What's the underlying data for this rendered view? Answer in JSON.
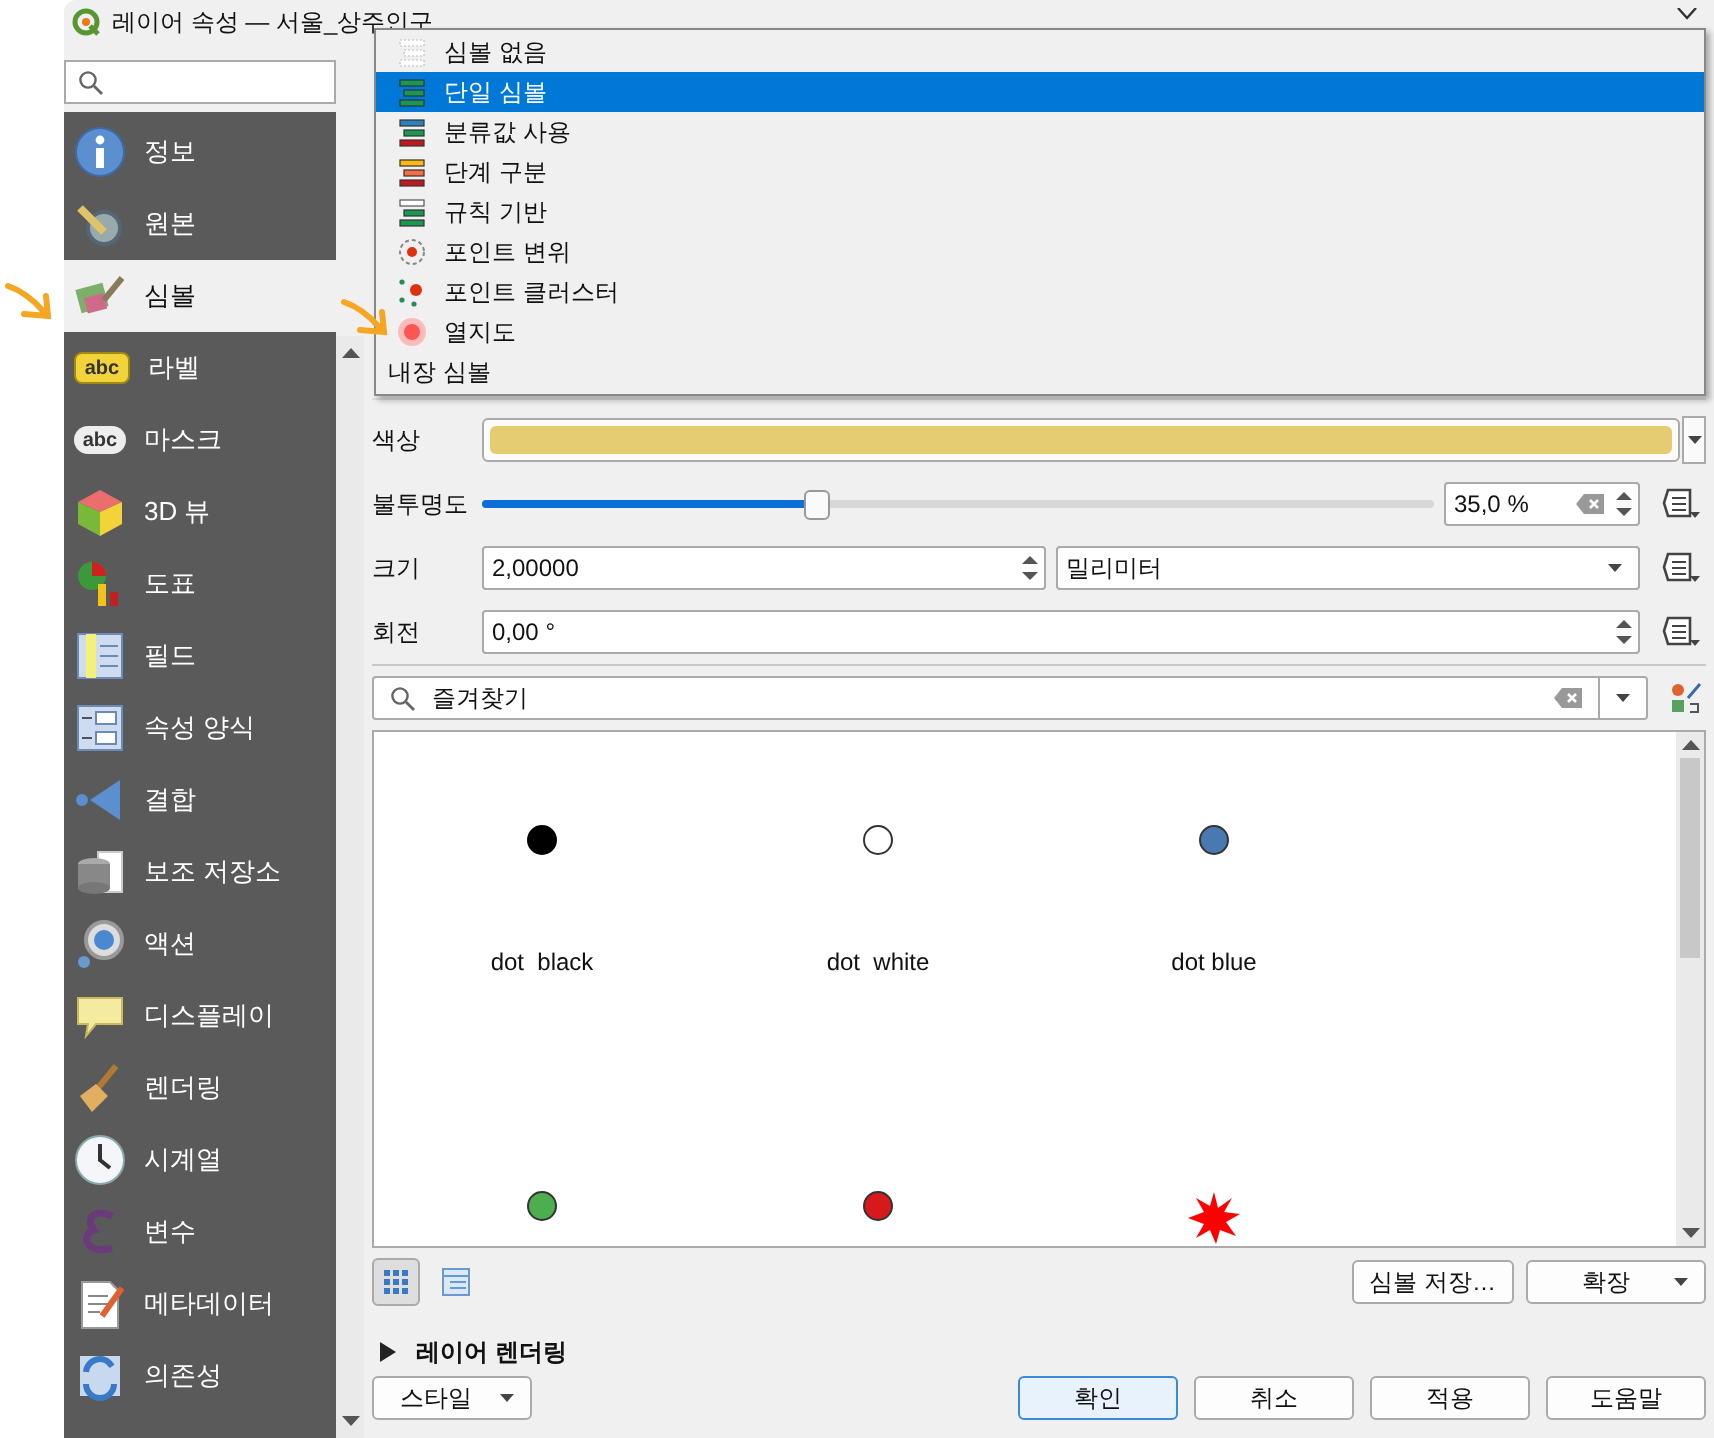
{
  "window": {
    "title": "레이어 속성 — 서울_상주인구"
  },
  "sidebar": {
    "items": [
      {
        "label": "정보",
        "selected": false
      },
      {
        "label": "원본",
        "selected": false
      },
      {
        "label": "심볼",
        "selected": true
      },
      {
        "label": "라벨",
        "selected": false,
        "badge": "abc"
      },
      {
        "label": "마스크",
        "selected": false,
        "badge": "abc"
      },
      {
        "label": "3D 뷰",
        "selected": false
      },
      {
        "label": "도표",
        "selected": false
      },
      {
        "label": "필드",
        "selected": false
      },
      {
        "label": "속성 양식",
        "selected": false
      },
      {
        "label": "결합",
        "selected": false
      },
      {
        "label": "보조 저장소",
        "selected": false
      },
      {
        "label": "액션",
        "selected": false
      },
      {
        "label": "디스플레이",
        "selected": false
      },
      {
        "label": "렌더링",
        "selected": false
      },
      {
        "label": "시계열",
        "selected": false
      },
      {
        "label": "변수",
        "selected": false
      },
      {
        "label": "메타데이터",
        "selected": false
      },
      {
        "label": "의존성",
        "selected": false
      }
    ]
  },
  "renderer_menu": {
    "items": [
      {
        "label": "심볼 없음",
        "kind": "renderer",
        "selected": false
      },
      {
        "label": "단일 심볼",
        "kind": "renderer",
        "selected": true
      },
      {
        "label": "분류값 사용",
        "kind": "renderer",
        "selected": false
      },
      {
        "label": "단계 구분",
        "kind": "renderer",
        "selected": false
      },
      {
        "label": "규칙 기반",
        "kind": "renderer",
        "selected": false
      },
      {
        "label": "포인트 변위",
        "kind": "renderer",
        "selected": false
      },
      {
        "label": "포인트 클러스터",
        "kind": "renderer",
        "selected": false
      },
      {
        "label": "열지도",
        "kind": "renderer",
        "selected": false
      },
      {
        "label": "내장 심볼",
        "kind": "embedded",
        "selected": false
      }
    ]
  },
  "symbol_settings": {
    "color": {
      "label": "색상"
    },
    "opacity": {
      "label": "불투명도",
      "level": 0.35,
      "value": "35,0 %"
    },
    "size": {
      "label": "크기",
      "value": "2,00000",
      "unit": "밀리미터"
    },
    "rotation": {
      "label": "회전",
      "value": "0,00 °"
    }
  },
  "library": {
    "search": {
      "value": "즐겨찾기"
    },
    "symbols": [
      {
        "label": "dot  black",
        "kind": "dot",
        "color": "#000000"
      },
      {
        "label": "dot  white",
        "kind": "dot",
        "color": "#ffffff"
      },
      {
        "label": "dot blue",
        "kind": "dot",
        "color": "#4a78b0"
      },
      {
        "kind": "dot",
        "color": "#4cae4c"
      },
      {
        "kind": "dot",
        "color": "#d7191c"
      },
      {
        "kind": "star",
        "color": "#ff0000"
      }
    ],
    "buttons": [
      "심볼 저장…",
      "확장"
    ]
  },
  "layer_rendering": {
    "label": "레이어 렌더링",
    "expanded": false
  },
  "style_button": "스타일",
  "buttons": [
    {
      "label": "확인",
      "default": true
    },
    {
      "label": "취소",
      "default": false
    },
    {
      "label": "적용",
      "default": false
    },
    {
      "label": "도움말",
      "default": false
    }
  ]
}
